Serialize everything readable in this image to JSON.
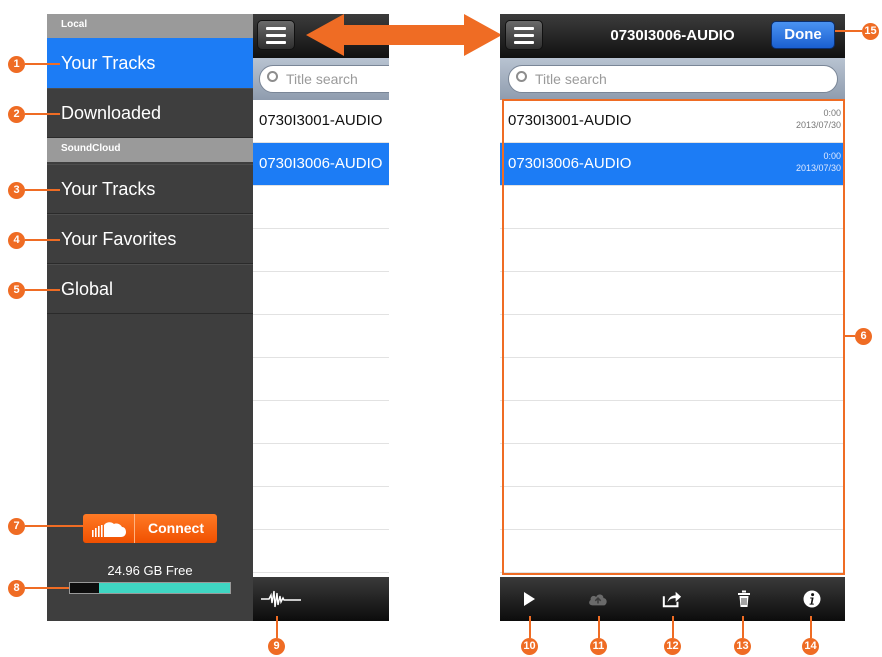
{
  "menu": {
    "sections": [
      {
        "label": "Local"
      },
      {
        "label": "SoundCloud"
      }
    ],
    "items": [
      {
        "label": "Your Tracks",
        "active": true
      },
      {
        "label": "Downloaded",
        "active": false
      },
      {
        "label": "Your Tracks",
        "active": false
      },
      {
        "label": "Your Favorites",
        "active": false
      },
      {
        "label": "Global",
        "active": false
      }
    ],
    "connect_label": "Connect",
    "storage": {
      "label": "24.96 GB Free",
      "used_fraction": 0.18
    }
  },
  "search": {
    "placeholder": "Title search"
  },
  "tracks": [
    {
      "title": "0730I3001-AUDIO",
      "duration": "0:00",
      "date": "2013/07/30",
      "selected": false
    },
    {
      "title": "0730I3006-AUDIO",
      "duration": "0:00",
      "date": "2013/07/30",
      "selected": true
    }
  ],
  "detail": {
    "title": "0730I3006-AUDIO",
    "done_label": "Done"
  },
  "toolbar_icons": [
    "play-icon",
    "cloud-upload-icon",
    "share-icon",
    "trash-icon",
    "info-icon"
  ],
  "waveform_icon": "waveform-icon",
  "callouts": [
    "1",
    "2",
    "3",
    "4",
    "5",
    "6",
    "7",
    "8",
    "9",
    "10",
    "11",
    "12",
    "13",
    "14",
    "15"
  ],
  "colors": {
    "accent_orange": "#ef6c24",
    "selection_blue": "#1c7cf5",
    "menu_bg": "#3e3e3e",
    "storage_free": "#3fd6c3",
    "soundcloud_orange": "#f05000"
  }
}
